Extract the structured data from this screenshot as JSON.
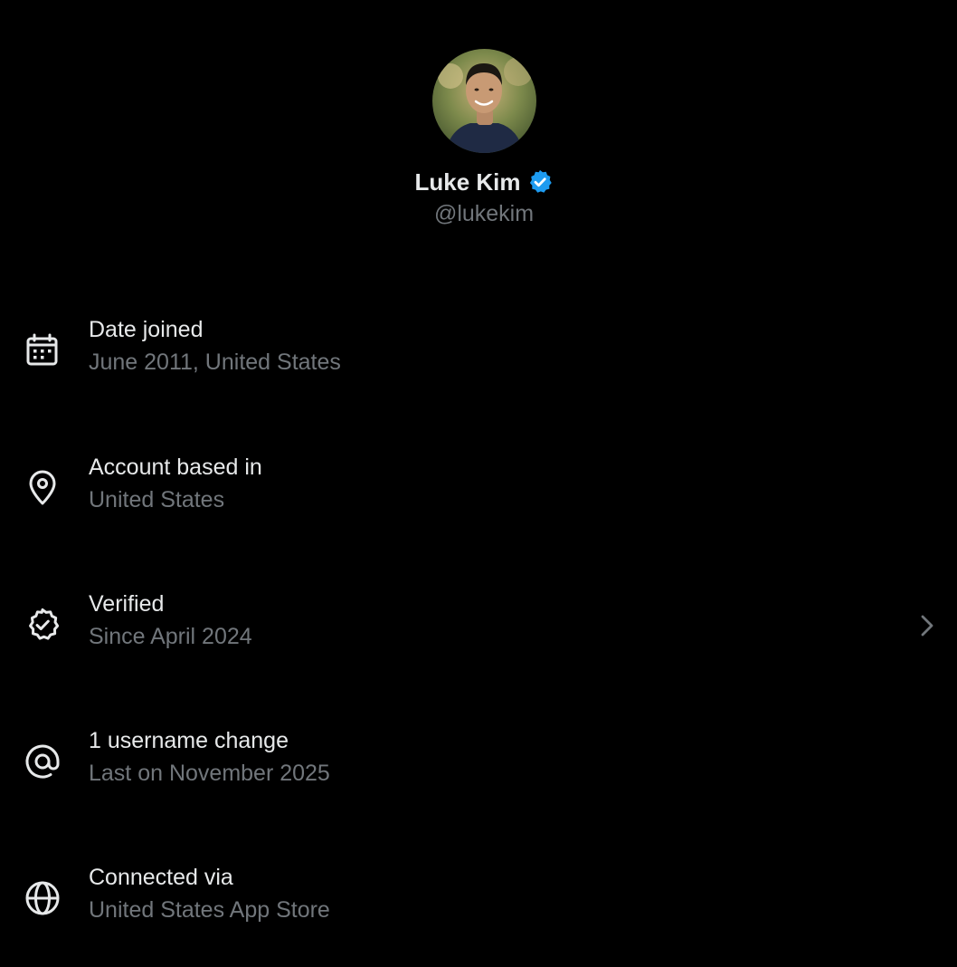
{
  "profile": {
    "display_name": "Luke Kim",
    "handle": "@lukekim",
    "verified": true
  },
  "colors": {
    "background": "#000000",
    "primary_text": "#e7e9ea",
    "secondary_text": "#71767b",
    "verified_blue": "#1d9bf0"
  },
  "rows": [
    {
      "icon": "calendar-icon",
      "title": "Date joined",
      "subtitle": "June 2011, United States"
    },
    {
      "icon": "location-pin-icon",
      "title": "Account based in",
      "subtitle": "United States"
    },
    {
      "icon": "verified-badge-icon",
      "title": "Verified",
      "subtitle": "Since April 2024",
      "has_chevron": true
    },
    {
      "icon": "at-sign-icon",
      "title": "1 username change",
      "subtitle": "Last on November 2025"
    },
    {
      "icon": "globe-icon",
      "title": "Connected via",
      "subtitle": "United States App Store"
    }
  ]
}
